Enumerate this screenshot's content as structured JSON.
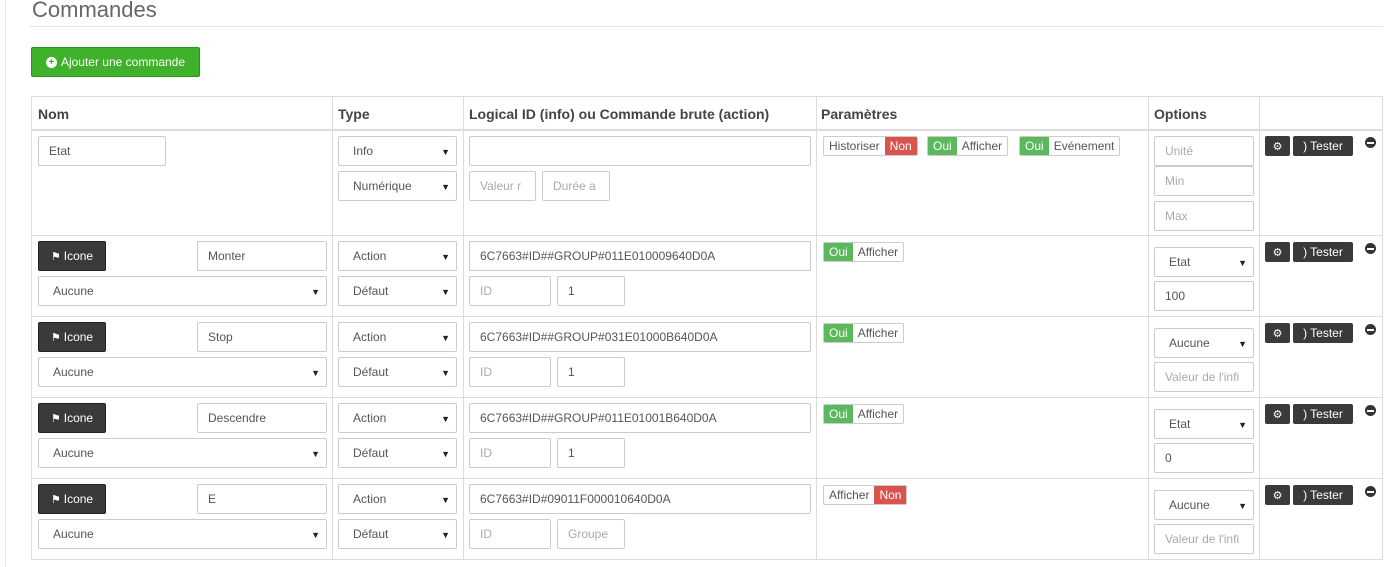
{
  "page": {
    "title": "Commandes"
  },
  "toolbar": {
    "add_label": "Ajouter une commande",
    "add_icon": "plus-circle-icon"
  },
  "table": {
    "headers": [
      "Nom",
      "Type",
      "Logical ID (info) ou Commande brute (action)",
      "Paramètres",
      "Options"
    ]
  },
  "actions": {
    "test_label": "Tester",
    "icon_label": "Icone"
  },
  "rows": [
    {
      "name": "Etat",
      "type": "Info",
      "subtype": "Numérique",
      "logical_id": "",
      "extra1_placeholder": "Valeur r",
      "extra2_placeholder": "Durée a",
      "params": {
        "historiser_label": "Historiser",
        "historiser_value": "Non",
        "afficher_value": "Oui",
        "afficher_label": "Afficher",
        "event_value": "Oui",
        "event_label": "Evénement"
      },
      "options": {
        "unite_placeholder": "Unité",
        "min_placeholder": "Min",
        "max_placeholder": "Max"
      }
    },
    {
      "name": "Monter",
      "type": "Action",
      "subtype": "Défaut",
      "value_select": "Aucune",
      "logical_id": "6C7663#ID##GROUP#011E010009640D0A",
      "id_placeholder": "ID",
      "id_value": "1",
      "params": {
        "afficher_value": "Oui",
        "afficher_label": "Afficher"
      },
      "options": {
        "select": "Etat",
        "value": "100"
      }
    },
    {
      "name": "Stop",
      "type": "Action",
      "subtype": "Défaut",
      "value_select": "Aucune",
      "logical_id": "6C7663#ID##GROUP#031E01000B640D0A",
      "id_placeholder": "ID",
      "id_value": "1",
      "params": {
        "afficher_value": "Oui",
        "afficher_label": "Afficher"
      },
      "options": {
        "select": "Aucune",
        "value_placeholder": "Valeur de l'infi"
      }
    },
    {
      "name": "Descendre",
      "type": "Action",
      "subtype": "Défaut",
      "value_select": "Aucune",
      "logical_id": "6C7663#ID##GROUP#011E01001B640D0A",
      "id_placeholder": "ID",
      "id_value": "1",
      "params": {
        "afficher_value": "Oui",
        "afficher_label": "Afficher"
      },
      "options": {
        "select": "Etat",
        "value": "0"
      }
    },
    {
      "name": "E",
      "type": "Action",
      "subtype": "Défaut",
      "value_select": "Aucune",
      "logical_id": "6C7663#ID#09011F000010640D0A",
      "id_placeholder": "ID",
      "groupe_placeholder": "Groupe",
      "params": {
        "afficher_label": "Afficher",
        "afficher_value": "Non"
      },
      "options": {
        "select": "Aucune",
        "value_placeholder": "Valeur de l'infi"
      }
    }
  ],
  "colors": {
    "green": "#3fb12b",
    "danger": "#d9534f",
    "success": "#5cb85c",
    "dark_button": "#3a3a3a"
  }
}
